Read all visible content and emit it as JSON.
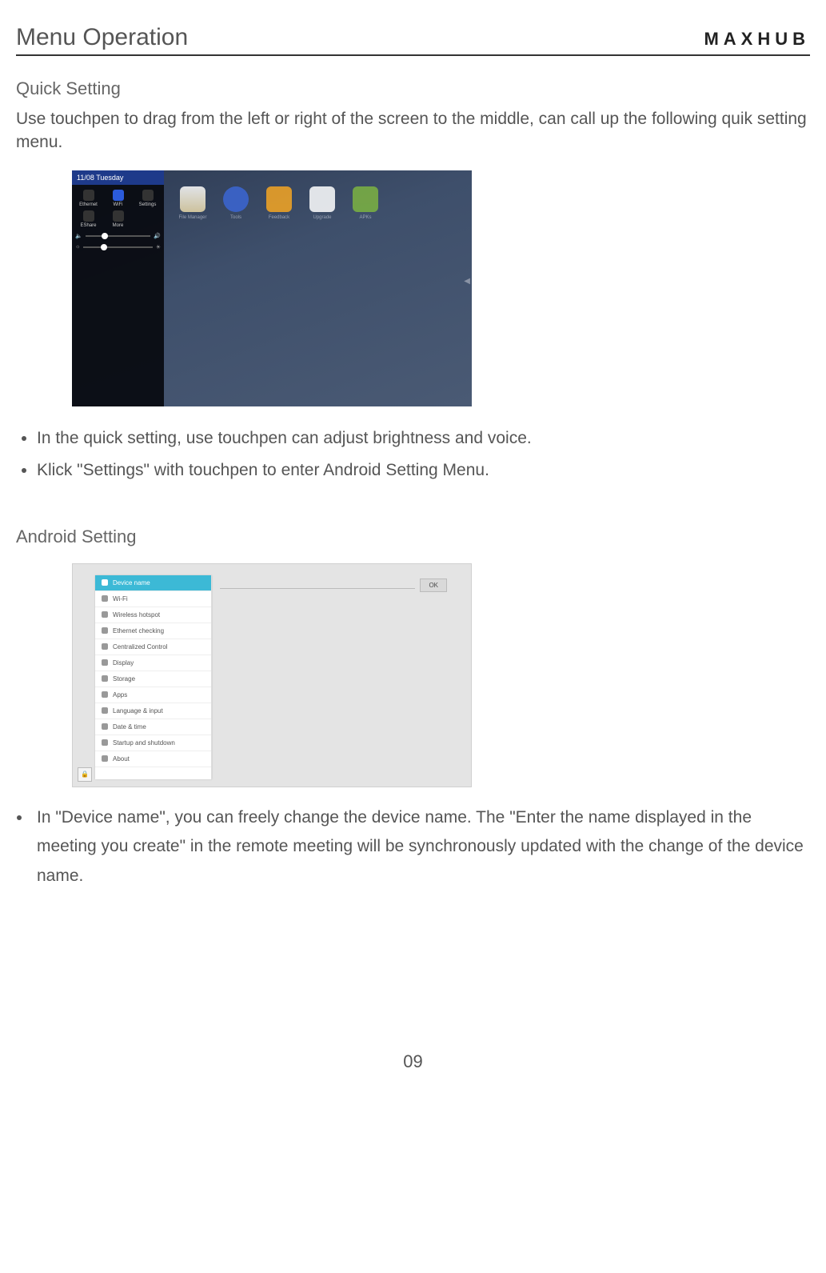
{
  "header": {
    "title": "Menu Operation",
    "brand": "MAXHUB"
  },
  "section1": {
    "title": "Quick Setting",
    "intro": "Use touchpen to drag from the left or right of the screen to the middle, can call up the following quik setting menu."
  },
  "quick_panel": {
    "date": "11/08 Tuesday",
    "tiles_row1": [
      "Ethernet",
      "WiFi",
      "Settings"
    ],
    "tiles_row2": [
      "EShare",
      "More",
      ""
    ],
    "desktop_labels": [
      "File Manager",
      "Tools",
      "Feedback",
      "Upgrade",
      "APKs"
    ]
  },
  "bullets1": [
    "In the quick setting, use touchpen can adjust brightness and voice.",
    "Klick \"Settings\" with touchpen to enter Android Setting Menu."
  ],
  "section2": {
    "title": "Android Setting"
  },
  "settings_menu": {
    "items": [
      "Device name",
      "Wi-Fi",
      "Wireless hotspot",
      "Ethernet checking",
      "Centralized Control",
      "Display",
      "Storage",
      "Apps",
      "Language & input",
      "Date & time",
      "Startup and shutdown",
      "About"
    ],
    "ok_label": "OK"
  },
  "bullets2": [
    "In \"Device name\", you can freely change the device name. The \"Enter the name displayed in the meeting you create\" in the remote meeting will be synchronously updated with the change of the device name."
  ],
  "page_number": "09"
}
